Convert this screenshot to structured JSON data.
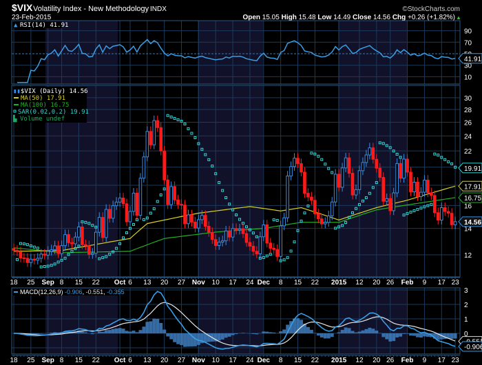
{
  "header": {
    "symbol": "$VIX",
    "name": "Volatility Index - New Methodology",
    "exchange": "INDX",
    "date": "23-Feb-2015",
    "copyright": "©StockCharts.com",
    "open_label": "Open",
    "open": "15.05",
    "high_label": "High",
    "high": "15.48",
    "low_label": "Low",
    "low": "14.49",
    "close_label": "Close",
    "close": "14.56",
    "chg_label": "Chg",
    "chg": "+0.26 (+1.82%)",
    "chg_arrow": "▲"
  },
  "colors": {
    "background": "#000000",
    "shade": "#11122a",
    "grid": "#1c3a5c",
    "border": "#2a5680",
    "up": "#3a8ee6",
    "down": "#ff1a1a",
    "ma50": "#d8d020",
    "ma100": "#22b022",
    "sar": "#33d6d6",
    "rsi": "#3a9ee6",
    "macd": "#3a9ee6",
    "signal": "#e8e8e8",
    "hist": "#3f7fbf",
    "positive": "#22cc22"
  },
  "chart_data": [
    {
      "type": "candlestick",
      "title": "$VIX (Daily) 14.56",
      "dates": [
        "Aug 18",
        "Aug 19",
        "Aug 20",
        "Aug 21",
        "Aug 22",
        "Aug 25",
        "Aug 26",
        "Aug 27",
        "Aug 28",
        "Aug 29",
        "Sep 2",
        "Sep 3",
        "Sep 4",
        "Sep 5",
        "Sep 8",
        "Sep 9",
        "Sep 10",
        "Sep 11",
        "Sep 12",
        "Sep 15",
        "Sep 16",
        "Sep 17",
        "Sep 18",
        "Sep 19",
        "Sep 22",
        "Sep 23",
        "Sep 24",
        "Sep 25",
        "Sep 26",
        "Sep 29",
        "Sep 30",
        "Oct 1",
        "Oct 2",
        "Oct 3",
        "Oct 6",
        "Oct 7",
        "Oct 8",
        "Oct 9",
        "Oct 10",
        "Oct 13",
        "Oct 14",
        "Oct 15",
        "Oct 16",
        "Oct 17",
        "Oct 20",
        "Oct 21",
        "Oct 22",
        "Oct 23",
        "Oct 24",
        "Oct 27",
        "Oct 28",
        "Oct 29",
        "Oct 30",
        "Oct 31",
        "Nov 3",
        "Nov 4",
        "Nov 5",
        "Nov 6",
        "Nov 7",
        "Nov 10",
        "Nov 11",
        "Nov 12",
        "Nov 13",
        "Nov 14",
        "Nov 17",
        "Nov 18",
        "Nov 19",
        "Nov 20",
        "Nov 21",
        "Nov 24",
        "Nov 25",
        "Nov 26",
        "Nov 28",
        "Dec 1",
        "Dec 2",
        "Dec 3",
        "Dec 4",
        "Dec 5",
        "Dec 8",
        "Dec 9",
        "Dec 10",
        "Dec 11",
        "Dec 12",
        "Dec 15",
        "Dec 16",
        "Dec 17",
        "Dec 18",
        "Dec 19",
        "Dec 22",
        "Dec 23",
        "Dec 24",
        "Dec 26",
        "Dec 29",
        "Dec 30",
        "Dec 31",
        "Jan 2",
        "Jan 5",
        "Jan 6",
        "Jan 7",
        "Jan 8",
        "Jan 9",
        "Jan 12",
        "Jan 13",
        "Jan 14",
        "Jan 15",
        "Jan 16",
        "Jan 20",
        "Jan 21",
        "Jan 22",
        "Jan 23",
        "Jan 26",
        "Jan 27",
        "Jan 28",
        "Jan 29",
        "Jan 30",
        "Feb 2",
        "Feb 3",
        "Feb 4",
        "Feb 5",
        "Feb 6",
        "Feb 9",
        "Feb 10",
        "Feb 11",
        "Feb 12",
        "Feb 13",
        "Feb 17",
        "Feb 18",
        "Feb 19",
        "Feb 20",
        "Feb 23"
      ],
      "close": [
        12.32,
        12.21,
        11.78,
        11.76,
        11.47,
        11.7,
        11.63,
        11.76,
        12.05,
        11.98,
        12.25,
        12.36,
        12.64,
        12.09,
        12.66,
        13.5,
        12.88,
        12.8,
        13.31,
        14.12,
        12.73,
        12.65,
        12.03,
        12.11,
        13.69,
        14.93,
        13.27,
        15.64,
        14.85,
        15.98,
        16.31,
        16.71,
        16.16,
        14.55,
        15.46,
        17.2,
        15.11,
        18.76,
        21.24,
        24.64,
        22.79,
        26.25,
        25.2,
        21.99,
        18.57,
        16.08,
        17.87,
        16.53,
        16.11,
        16.04,
        14.39,
        15.15,
        14.52,
        14.03,
        14.73,
        15.1,
        14.17,
        13.67,
        13.12,
        12.67,
        12.92,
        13.02,
        13.79,
        13.31,
        13.99,
        13.86,
        13.96,
        13.58,
        12.9,
        12.62,
        12.25,
        12.07,
        13.33,
        14.29,
        12.85,
        12.47,
        12.38,
        11.89,
        14.21,
        14.89,
        19.0,
        20.08,
        21.08,
        20.42,
        19.44,
        17.18,
        16.81,
        16.49,
        15.25,
        14.8,
        14.37,
        14.5,
        15.06,
        16.33,
        19.2,
        17.79,
        19.92,
        21.12,
        19.31,
        17.01,
        17.55,
        19.6,
        20.56,
        21.48,
        22.39,
        20.95,
        19.89,
        18.85,
        16.4,
        16.66,
        15.52,
        17.22,
        20.44,
        18.76,
        20.97,
        19.43,
        17.33,
        18.33,
        16.85,
        17.29,
        18.55,
        17.23,
        16.96,
        15.34,
        14.69,
        15.8,
        15.45,
        15.29,
        14.3,
        14.56
      ],
      "ma50_points": [
        [
          0,
          12.25
        ],
        [
          14,
          12.3
        ],
        [
          34,
          13.2
        ],
        [
          39,
          14.4
        ],
        [
          54,
          15.3
        ],
        [
          69,
          15.9
        ],
        [
          78,
          15.5
        ],
        [
          84,
          15.8
        ],
        [
          95,
          14.7
        ],
        [
          106,
          15.8
        ],
        [
          115,
          16.5
        ],
        [
          129,
          17.91
        ]
      ],
      "ma100_points": [
        [
          0,
          12.5
        ],
        [
          14,
          12.15
        ],
        [
          34,
          12.25
        ],
        [
          44,
          13.2
        ],
        [
          59,
          13.7
        ],
        [
          73,
          14.0
        ],
        [
          84,
          14.5
        ],
        [
          95,
          14.5
        ],
        [
          106,
          15.6
        ],
        [
          120,
          16.3
        ],
        [
          129,
          16.75
        ]
      ],
      "y_scale": "log",
      "ylim": [
        10.5,
        32.2
      ],
      "y_ticks": [
        "30",
        "28",
        "26",
        "24",
        "22",
        "16",
        "14",
        "12"
      ],
      "legend": {
        "price": "$VIX (Daily) 14.56",
        "ma50": "MA(50) 17.91",
        "ma100": "MA(100) 16.75",
        "sar": "SAR(0.02,0.2) 19.91",
        "volume": "Volume undef"
      },
      "last_values": {
        "sar": "19.91",
        "ma50": "17.91",
        "ma100": "16.75",
        "price": "14.56"
      }
    },
    {
      "type": "line",
      "title": "RSI(14) 41.91",
      "ylim": [
        0,
        100
      ],
      "y_ticks": [
        "90",
        "70",
        "50",
        "30",
        "10"
      ],
      "last_value": "41.91"
    },
    {
      "type": "line",
      "title": "MACD(12,26,9)",
      "values_text": {
        "macd": "-0.906",
        "signal": "-0.551",
        "hist": "-0.355"
      },
      "ylim": [
        -1.4,
        3.2
      ],
      "y_ticks": [
        "3",
        "2",
        "1",
        "0"
      ],
      "last_values": {
        "signal": "-0.551",
        "macd": "-0.906"
      }
    }
  ],
  "x_ticks": [
    {
      "i": 0,
      "label": "18"
    },
    {
      "i": 5,
      "label": "25"
    },
    {
      "i": 10,
      "label": "Sep",
      "bold": true
    },
    {
      "i": 14,
      "label": "8"
    },
    {
      "i": 19,
      "label": "15"
    },
    {
      "i": 24,
      "label": "22"
    },
    {
      "i": 31,
      "label": "Oct",
      "bold": true
    },
    {
      "i": 34,
      "label": "6"
    },
    {
      "i": 39,
      "label": "13"
    },
    {
      "i": 44,
      "label": "20"
    },
    {
      "i": 49,
      "label": "27"
    },
    {
      "i": 54,
      "label": "Nov",
      "bold": true
    },
    {
      "i": 59,
      "label": "10"
    },
    {
      "i": 64,
      "label": "17"
    },
    {
      "i": 69,
      "label": "24"
    },
    {
      "i": 73,
      "label": "Dec",
      "bold": true
    },
    {
      "i": 78,
      "label": "8"
    },
    {
      "i": 83,
      "label": "15"
    },
    {
      "i": 88,
      "label": "22"
    },
    {
      "i": 95,
      "label": "2015",
      "bold": true
    },
    {
      "i": 101,
      "label": "12"
    },
    {
      "i": 106,
      "label": "20"
    },
    {
      "i": 110,
      "label": "26"
    },
    {
      "i": 115,
      "label": "Feb",
      "bold": true
    },
    {
      "i": 120,
      "label": "9"
    },
    {
      "i": 125,
      "label": "17"
    },
    {
      "i": 129,
      "label": "23"
    }
  ]
}
